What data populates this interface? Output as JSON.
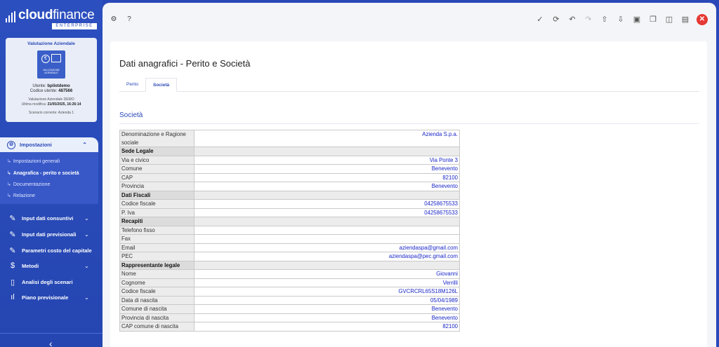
{
  "brand": {
    "name_bold": "cloud",
    "name_thin": "finance",
    "tag": "ENTERPRISE"
  },
  "card": {
    "title": "Valutazione Aziendale",
    "image_caption": "VALUTAZIONE AZIENDALE",
    "user_label": "Utente:",
    "user_value": "bpilotdemo",
    "code_label": "Codice utente:",
    "code_value": "487566",
    "project": "Valutazione Aziendale DEMO",
    "last_mod_label": "Ultima modifica:",
    "last_mod_value": "21/05/2025, 16:26:14",
    "scenario": "Scenario corrente: Azienda 1"
  },
  "sidebar": {
    "section": {
      "label": "Impostazioni",
      "icon": "gear-icon"
    },
    "subitems": [
      {
        "label": "Impostazioni generali",
        "active": false
      },
      {
        "label": "Anagrafica - perito e società",
        "active": true
      },
      {
        "label": "Documentazione",
        "active": false
      },
      {
        "label": "Relazione",
        "active": false
      }
    ],
    "items": [
      {
        "label": "Input dati consuntivi",
        "icon": "edit-icon",
        "glyph": "✎",
        "chevron": true
      },
      {
        "label": "Input dati previsionali",
        "icon": "edit-icon",
        "glyph": "✎",
        "chevron": true
      },
      {
        "label": "Parametri costo del capitale",
        "icon": "edit-icon",
        "glyph": "✎",
        "chevron": false
      },
      {
        "label": "Metodi",
        "icon": "dollar-icon",
        "glyph": "$",
        "chevron": true
      },
      {
        "label": "Analisi degli scenari",
        "icon": "columns-icon",
        "glyph": "▯",
        "chevron": false
      },
      {
        "label": "Piano previsionale",
        "icon": "bar-chart-icon",
        "glyph": "ıl",
        "chevron": true
      }
    ],
    "collapse_glyph": "‹"
  },
  "toolbar": {
    "left_icons": [
      "settings-icon",
      "help-icon"
    ],
    "right_icons": [
      "check-icon",
      "refresh-icon",
      "undo-icon",
      "redo-icon",
      "upload-icon",
      "download-icon",
      "save-icon",
      "copy-icon",
      "panel-icon",
      "layout-icon"
    ],
    "close_icon": "close-icon"
  },
  "page": {
    "title": "Dati anagrafici - Perito e Società",
    "tabs": [
      {
        "label": "Perito",
        "active": false
      },
      {
        "label": "Società",
        "active": true
      }
    ],
    "section_title": "Società"
  },
  "table": [
    {
      "type": "row",
      "key": "Denominazione e Ragione sociale",
      "value": "Azienda S.p.a."
    },
    {
      "type": "sec",
      "key": "Sede Legale",
      "value": ""
    },
    {
      "type": "row",
      "key": "Via e civico",
      "value": "Via Ponte 3"
    },
    {
      "type": "row",
      "key": "Comune",
      "value": "Benevento"
    },
    {
      "type": "row",
      "key": "CAP",
      "value": "82100"
    },
    {
      "type": "row",
      "key": "Provincia",
      "value": "Benevento"
    },
    {
      "type": "sec",
      "key": "Dati Fiscali",
      "value": ""
    },
    {
      "type": "row",
      "key": "Codice fiscale",
      "value": "04258675533"
    },
    {
      "type": "row",
      "key": "P. Iva",
      "value": "04258675533"
    },
    {
      "type": "sec",
      "key": "Recapiti",
      "value": ""
    },
    {
      "type": "row",
      "key": "Telefono fisso",
      "value": ""
    },
    {
      "type": "row",
      "key": "Fax",
      "value": ""
    },
    {
      "type": "row",
      "key": "Email",
      "value": "aziendaspa@gmail.com"
    },
    {
      "type": "row",
      "key": "PEC",
      "value": "aziendaspa@pec.gmail.com"
    },
    {
      "type": "sec",
      "key": "Rappresentante legale",
      "value": ""
    },
    {
      "type": "row",
      "key": "Nome",
      "value": "Giovanni"
    },
    {
      "type": "row",
      "key": "Cognome",
      "value": "Verrilli"
    },
    {
      "type": "row",
      "key": "Codice fiscale",
      "value": "GVCRCRL65S18M126L"
    },
    {
      "type": "row",
      "key": "Data di nascita",
      "value": "05/04/1989"
    },
    {
      "type": "row",
      "key": "Comune di nascita",
      "value": "Benevento"
    },
    {
      "type": "row",
      "key": "Provincia di nascita",
      "value": "Benevento"
    },
    {
      "type": "row",
      "key": "CAP comune di nascita",
      "value": "82100"
    }
  ],
  "colors": {
    "brand": "#2a49b8",
    "value_text": "#1a27c8",
    "close": "#e53935"
  }
}
